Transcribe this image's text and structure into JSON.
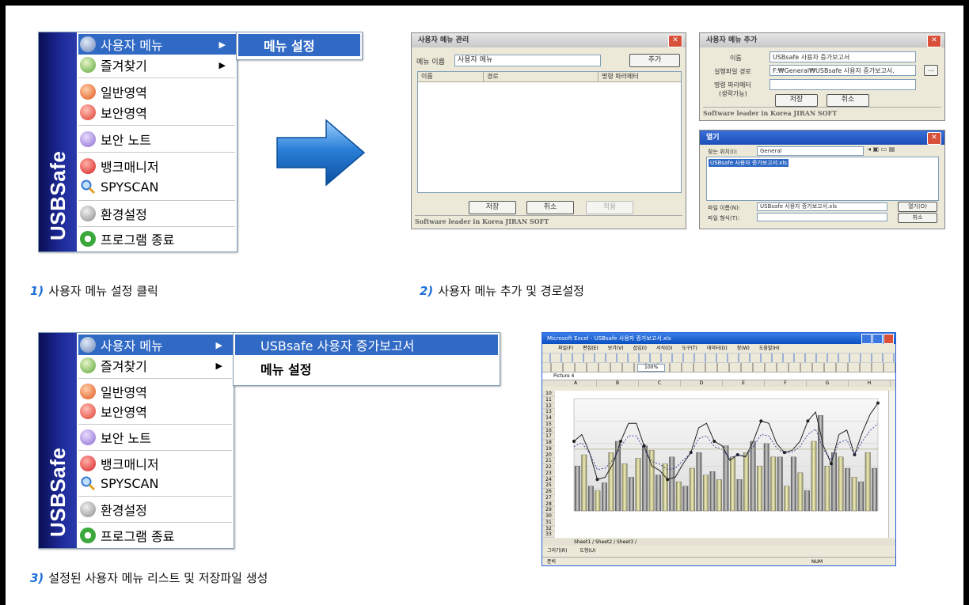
{
  "menu1": {
    "brand": "USBSafe",
    "items": [
      {
        "label": "사용자 메뉴",
        "arrow": "▶",
        "icon": "user-menu-icon",
        "color": "#6d87b8"
      },
      {
        "label": "즐겨찾기",
        "arrow": "▶",
        "icon": "favorites-icon",
        "color": "#58a437"
      },
      {
        "label": "일반영역",
        "icon": "general-area-icon",
        "color": "#e0541c"
      },
      {
        "label": "보안영역",
        "icon": "secure-area-icon",
        "color": "#e0392a"
      },
      {
        "label": "보안 노트",
        "icon": "secure-note-icon",
        "color": "#8a6ad0"
      },
      {
        "label": "뱅크매니저",
        "icon": "bank-manager-icon",
        "color": "#d62020"
      },
      {
        "label": "SPYSCAN",
        "icon": "magnifier-icon",
        "color": "#3a77d8"
      },
      {
        "label": "환경설정",
        "icon": "settings-icon",
        "color": "#8a8a8a"
      },
      {
        "label": "프로그램 종료",
        "icon": "exit-icon",
        "color": "#3aa83a"
      }
    ],
    "submenu": [
      "메뉴 설정"
    ]
  },
  "menu2": {
    "brand": "USBSafe",
    "items": [
      {
        "label": "사용자 메뉴",
        "arrow": "▶"
      },
      {
        "label": "즐겨찾기",
        "arrow": "▶"
      },
      {
        "label": "일반영역"
      },
      {
        "label": "보안영역"
      },
      {
        "label": "보안 노트"
      },
      {
        "label": "뱅크매니저"
      },
      {
        "label": "SPYSCAN"
      },
      {
        "label": "환경설정"
      },
      {
        "label": "프로그램 종료"
      }
    ],
    "submenu": [
      "USBsafe 사용자 증가보고서",
      "메뉴 설정"
    ]
  },
  "dialog_manage": {
    "title": "사용자 메뉴 관리",
    "name_label": "메뉴 이름",
    "name_value": "사용자 메뉴",
    "add_button": "추가",
    "columns": [
      "이름",
      "경로",
      "명령 파라메터"
    ],
    "save_button": "저장",
    "cancel_button": "취소",
    "apply_button": "적용",
    "footer": "Software leader in Korea JIRAN SOFT"
  },
  "dialog_add": {
    "title": "사용자 메뉴 추가",
    "name_label": "이름",
    "name_value": "USBsafe 사용자 증가보고서",
    "path_label": "실행파일 경로",
    "path_value": "F:₩General₩USBsafe 사용자 증가보고서.",
    "browse_button": "...",
    "param_label": "명령 파라메터",
    "param_hint": "(생략가능)",
    "param_value": "",
    "save_button": "저장",
    "cancel_button": "취소",
    "footer": "Software leader in Korea JIRAN SOFT"
  },
  "dialog_open": {
    "title": "열기",
    "lookin_label": "찾는 위치(I):",
    "lookin_value": "General",
    "file_item": "USBsafe 사용자 증가보고서.xls",
    "filename_label": "파일 이름(N):",
    "filename_value": "USBsafe 사용자 증가보고서.xls",
    "filetype_label": "파일 형식(T):",
    "open_button": "열기(O)",
    "cancel_button": "취소"
  },
  "excel": {
    "title": "Microsoft Excel - USBsafe 사용자 증가보고서.xls",
    "menubar": [
      "파일(F)",
      "편집(E)",
      "보기(V)",
      "삽입(I)",
      "서식(O)",
      "도구(T)",
      "데이터(D)",
      "창(W)",
      "도움말(H)"
    ],
    "namebox": "Picture 4",
    "zoom": "100%",
    "columns": [
      "A",
      "B",
      "C",
      "D",
      "E",
      "F",
      "G",
      "H"
    ],
    "rows": [
      "10",
      "11",
      "12",
      "13",
      "14",
      "15",
      "16",
      "17",
      "18",
      "19",
      "20",
      "21",
      "22",
      "23",
      "24",
      "25",
      "26",
      "27",
      "28",
      "29",
      "30",
      "31",
      "32",
      "33"
    ],
    "sheet_tabs": "Sheet1 / Sheet2 / Sheet3 /",
    "draw_label": "그리기(R)",
    "autoshape_label": "도형(U)",
    "status_left": "준비",
    "status_right": "NUM",
    "bar_values": [
      40,
      50,
      22,
      18,
      25,
      52,
      62,
      42,
      30,
      47,
      58,
      54,
      32,
      42,
      48,
      26,
      22,
      38,
      52,
      32,
      35,
      28,
      58,
      48,
      28,
      52,
      62,
      40,
      60,
      48,
      48,
      22,
      48,
      34,
      18,
      62,
      85,
      40,
      52,
      48,
      38,
      30,
      26,
      52,
      38
    ],
    "line_values": [
      62,
      68,
      52,
      28,
      30,
      42,
      62,
      78,
      78,
      58,
      40,
      36,
      28,
      30,
      42,
      52,
      74,
      78,
      62,
      58,
      45,
      50,
      48,
      62,
      80,
      78,
      60,
      52,
      54,
      62,
      80,
      88,
      58,
      42,
      68,
      72,
      50,
      70,
      86,
      96
    ]
  },
  "captions": {
    "step1_num": "1)",
    "step1": "사용자 메뉴 설정 클릭",
    "step2_num": "2)",
    "step2": "사용자 메뉴 추가 및 경로설정",
    "step3_num": "3)",
    "step3": "설정된 사용자 메뉴 리스트 및 저장파일 생성"
  },
  "colors": {
    "menu_selected": "#316ac5",
    "caption_number": "#1e6fd9",
    "usbsafe_bar": "#0a0f55",
    "arrow": "#2a7fd8"
  }
}
